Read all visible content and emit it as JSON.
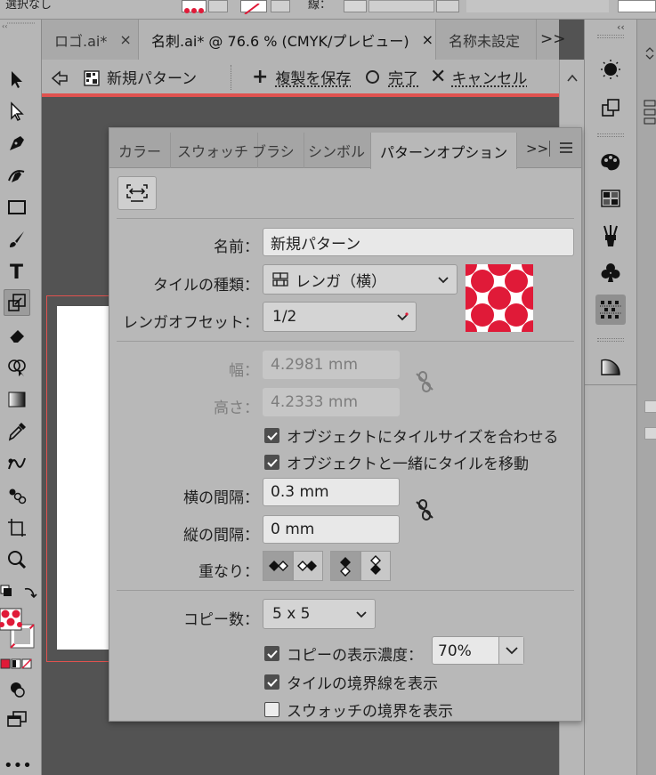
{
  "topbar": {
    "left_text": "選択なし",
    "stroke_label": "線："
  },
  "doc_tabs": [
    {
      "label": "ロゴ.ai*",
      "close": "×"
    },
    {
      "label": "名刺.ai* @ 76.6 % (CMYK/プレビュー)",
      "close": "×"
    },
    {
      "label": "名称未設定"
    }
  ],
  "doc_tabs_more": ">>",
  "isolation_bar": {
    "back_icon": "back-arrow-icon",
    "pattern_name": "新規パターン",
    "save_copy": "複製を保存",
    "done": "完了",
    "cancel": "キャンセル"
  },
  "panel": {
    "tabs": [
      "カラー",
      "スウォッチ",
      "ブラシ",
      "シンボル",
      "パターンオプション"
    ],
    "active_tab": "パターンオプション",
    "tabs_more": ">>",
    "name_label": "名前：",
    "name_value": "新規パターン",
    "tile_type_label": "タイルの種類：",
    "tile_type_value": "レンガ（横）",
    "brick_offset_label": "レンガオフセット：",
    "brick_offset_value": "1/2",
    "width_label": "幅：",
    "width_value": "4.2981 mm",
    "height_label": "高さ：",
    "height_value": "4.2333 mm",
    "fit_tile_label": "オブジェクトにタイルサイズを合わせる",
    "fit_tile_checked": true,
    "move_tile_label": "オブジェクトと一緒にタイルを移動",
    "move_tile_checked": true,
    "h_spacing_label": "横の間隔：",
    "h_spacing_value": "0.3 mm",
    "v_spacing_label": "縦の間隔：",
    "v_spacing_value": "0 mm",
    "overlap_label": "重なり：",
    "copies_label": "コピー数：",
    "copies_value": "5 x 5",
    "dim_copies_label": "コピーの表示濃度：",
    "dim_copies_checked": true,
    "dim_copies_value": "70%",
    "show_tile_edge_label": "タイルの境界線を表示",
    "show_tile_edge_checked": true,
    "show_swatch_bounds_label": "スウォッチの境界を表示",
    "show_swatch_bounds_checked": false
  },
  "colors": {
    "accent_red": "#e01a38",
    "selection_red": "#e0524f"
  }
}
